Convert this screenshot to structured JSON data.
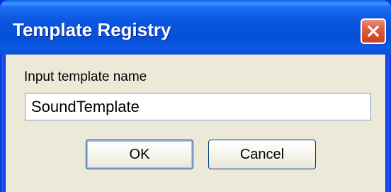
{
  "window": {
    "title": "Template Registry",
    "colors": {
      "titlebar": "#0a55df",
      "close_button": "#e0613f",
      "client_background": "#ece9d8",
      "input_border": "#7f9db9",
      "button_border": "#003c74"
    }
  },
  "titlebar": {
    "close_icon": "close-x-icon"
  },
  "form": {
    "prompt_label": "Input template name",
    "name_value": "SoundTemplate"
  },
  "buttons": {
    "ok_label": "OK",
    "cancel_label": "Cancel"
  }
}
